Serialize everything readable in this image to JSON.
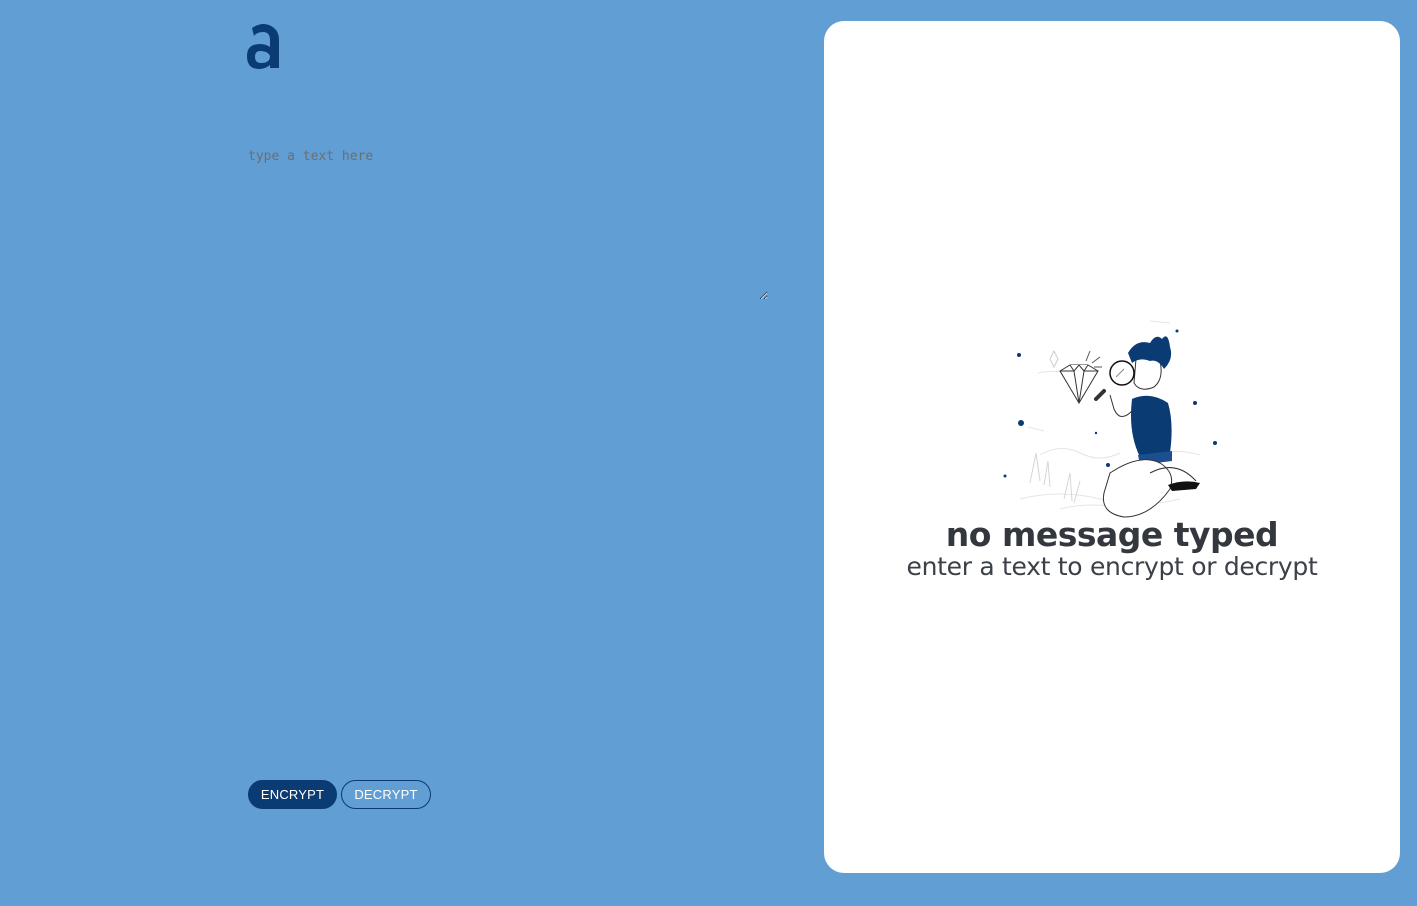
{
  "logo": {
    "icon": "a-letter-logo",
    "color": "#0b3b73"
  },
  "editor": {
    "placeholder": "type a text here",
    "value": ""
  },
  "actions": {
    "encrypt_label": "ENCRYPT",
    "decrypt_label": "DECRYPT"
  },
  "result": {
    "illustration_icon": "person-inspecting-diamond-illustration",
    "title": "no message typed",
    "subtitle": "enter a text to encrypt or decrypt"
  },
  "colors": {
    "background": "#619ed4",
    "accent": "#0b3b73",
    "card": "#ffffff"
  }
}
